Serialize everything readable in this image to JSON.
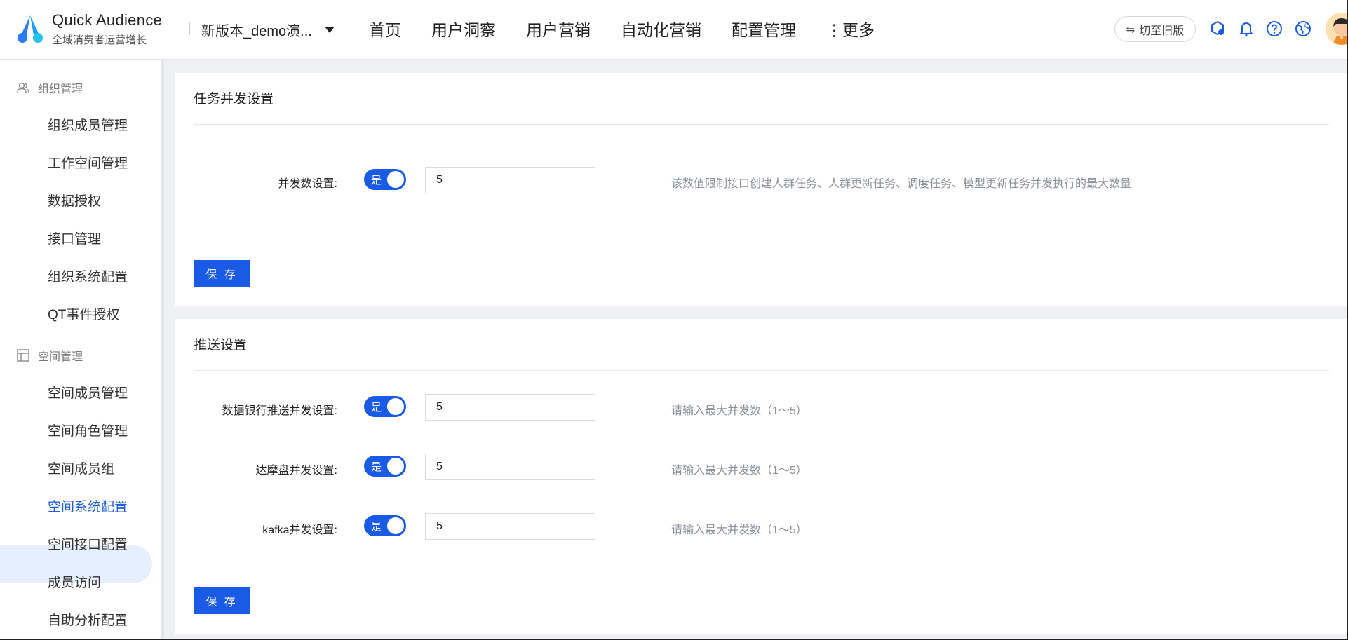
{
  "header": {
    "brand_name": "Quick Audience",
    "brand_sub": "全域消费者运营增长",
    "workspace": "新版本_demo演...",
    "nav": [
      "首页",
      "用户洞察",
      "用户营销",
      "自动化营销",
      "配置管理"
    ],
    "more": "⋮更多",
    "switch_old": "切至旧版",
    "icons": [
      "plugin-icon",
      "bell-icon",
      "help-icon",
      "globe-icon"
    ]
  },
  "sidebar": {
    "group1": "组织管理",
    "group1_items": [
      "组织成员管理",
      "工作空间管理",
      "数据授权",
      "接口管理",
      "组织系统配置",
      "QT事件授权"
    ],
    "group2": "空间管理",
    "group2_items": [
      "空间成员管理",
      "空间角色管理",
      "空间成员组",
      "空间系统配置",
      "空间接口配置",
      "成员访问",
      "自助分析配置"
    ],
    "active_item": "空间系统配置"
  },
  "task_card": {
    "title": "任务并发设置",
    "label": "并发数设置:",
    "toggle_label": "是",
    "toggle_on": true,
    "value": "5",
    "hint": "该数值限制接口创建人群任务、人群更新任务、调度任务、模型更新任务并发执行的最大数量",
    "save": "保 存"
  },
  "push_card": {
    "title": "推送设置",
    "rows": [
      {
        "label": "数据银行推送并发设置:",
        "toggle_label": "是",
        "toggle_on": true,
        "value": "5",
        "hint": "请输入最大并发数（1～5）"
      },
      {
        "label": "达摩盘并发设置:",
        "toggle_label": "是",
        "toggle_on": true,
        "value": "5",
        "hint": "请输入最大并发数（1～5）"
      },
      {
        "label": "kafka并发设置:",
        "toggle_label": "是",
        "toggle_on": true,
        "value": "5",
        "hint": "请输入最大并发数（1～5）"
      }
    ],
    "save": "保 存"
  },
  "colors": {
    "primary": "#1a5be6",
    "active_bg": "#e6effe",
    "hint": "#8a8f99"
  }
}
